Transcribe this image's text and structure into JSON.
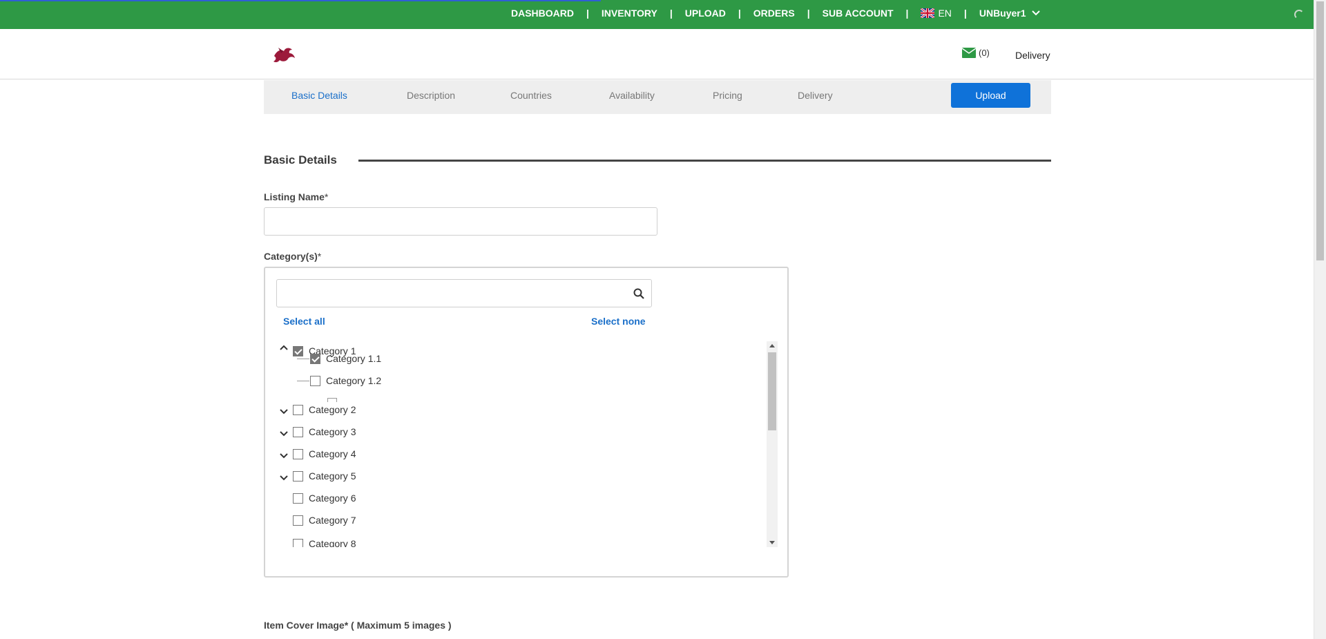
{
  "topnav": {
    "items": [
      "DASHBOARD",
      "INVENTORY",
      "UPLOAD",
      "ORDERS",
      "SUB ACCOUNT"
    ],
    "separator": "|",
    "language": "EN",
    "user": "UNBuyer1"
  },
  "header": {
    "mail_count": "(0)",
    "delivery_label": "Delivery"
  },
  "steps": {
    "items": [
      "Basic Details",
      "Description",
      "Countries",
      "Availability",
      "Pricing",
      "Delivery"
    ],
    "active": "Basic Details",
    "upload_label": "Upload"
  },
  "section": {
    "title": "Basic Details"
  },
  "form": {
    "listing_name_label": "Listing Name",
    "listing_name_value": "",
    "category_label": "Category(s)",
    "required_mark": "*",
    "category_search_value": "",
    "select_all": "Select all",
    "select_none": "Select none",
    "cover_image_label": "Item Cover Image",
    "cover_image_hint": " ( Maximum 5 images )"
  },
  "categories": [
    {
      "label": "Category 1",
      "checked": true,
      "expanded": true
    },
    {
      "label": "Category 1.1",
      "checked": true
    },
    {
      "label": "Category 1.2",
      "checked": false
    },
    {
      "label": "Category 2",
      "checked": false,
      "expanded": false
    },
    {
      "label": "Category 3",
      "checked": false,
      "expanded": false
    },
    {
      "label": "Category 4",
      "checked": false,
      "expanded": false
    },
    {
      "label": "Category 5",
      "checked": false,
      "expanded": false
    },
    {
      "label": "Category 6",
      "checked": false
    },
    {
      "label": "Category 7",
      "checked": false
    },
    {
      "label": "Category 8",
      "checked": false
    }
  ],
  "colors": {
    "topbar": "#2e9945",
    "accent": "#1a6fc9",
    "upload_button": "#0f72d9"
  }
}
